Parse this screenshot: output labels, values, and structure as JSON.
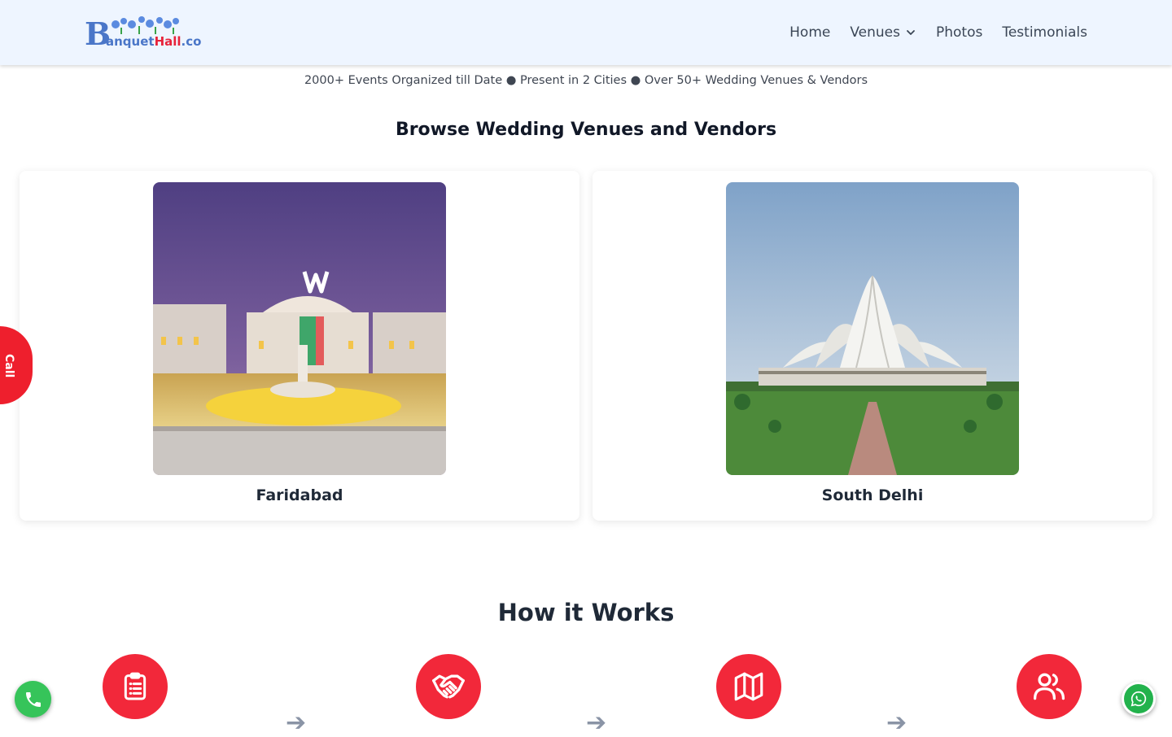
{
  "header": {
    "logo": {
      "letter": "B",
      "part1": "anquet",
      "part2": "Hall",
      "part3": ".co"
    },
    "nav": [
      {
        "label": "Home"
      },
      {
        "label": "Venues",
        "has_dropdown": true
      },
      {
        "label": "Photos"
      },
      {
        "label": "Testimonials"
      }
    ]
  },
  "stats_line": "2000+ Events Organized till Date ● Present in 2 Cities ● Over 50+ Wedding Venues & Vendors",
  "browse": {
    "title": "Browse Wedding Venues and Vendors",
    "cities": [
      {
        "name": "Faridabad"
      },
      {
        "name": "South Delhi"
      }
    ]
  },
  "how_it_works": {
    "title": "How it Works",
    "steps": [
      {
        "icon": "clipboard-icon"
      },
      {
        "icon": "handshake-icon"
      },
      {
        "icon": "map-icon"
      },
      {
        "icon": "users-icon"
      }
    ]
  },
  "floating": {
    "callback_label": "Call Back",
    "phone_icon": "phone-icon",
    "whatsapp_icon": "whatsapp-icon"
  },
  "colors": {
    "accent_red": "#f2283a",
    "header_bg": "#eef5ff",
    "brand_blue": "#4a76c8",
    "whatsapp_green": "#22b24c"
  }
}
